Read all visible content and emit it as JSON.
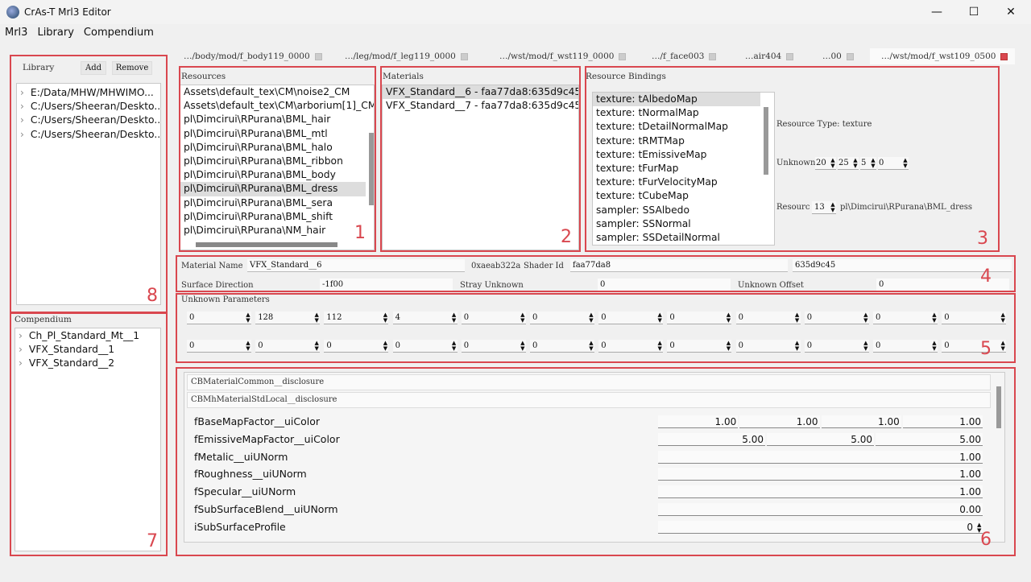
{
  "window": {
    "title": "CrAs-T Mrl3 Editor",
    "minimize": "—",
    "maximize": "☐",
    "close": "✕"
  },
  "menu": [
    "Mrl3",
    "Library",
    "Compendium"
  ],
  "tabs": [
    {
      "label": "…/body/mod/f_body119_0000",
      "active": false
    },
    {
      "label": "…/leg/mod/f_leg119_0000",
      "active": false
    },
    {
      "label": "…/wst/mod/f_wst119_0000",
      "active": false
    },
    {
      "label": "…/f_face003",
      "active": false
    },
    {
      "label": "…air404",
      "active": false
    },
    {
      "label": "…00",
      "active": false
    },
    {
      "label": "…/wst/mod/f_wst109_0500",
      "active": true
    }
  ],
  "library": {
    "title": "Library",
    "add": "Add",
    "remove": "Remove",
    "items": [
      "E:/Data/MHW/MHWIMO...",
      "C:/Users/Sheeran/Deskto...",
      "C:/Users/Sheeran/Deskto...",
      "C:/Users/Sheeran/Deskto..."
    ]
  },
  "compendium": {
    "title": "Compendium",
    "items": [
      "Ch_Pl_Standard_Mt__1",
      "VFX_Standard__1",
      "VFX_Standard__2"
    ]
  },
  "resources": {
    "title": "Resources",
    "selected": 7,
    "items": [
      "Assets\\default_tex\\CM\\noise2_CM",
      "Assets\\default_tex\\CM\\arborium[1]_CM",
      "pl\\Dimcirui\\RPurana\\BML_hair",
      "pl\\Dimcirui\\RPurana\\BML_mtl",
      "pl\\Dimcirui\\RPurana\\BML_halo",
      "pl\\Dimcirui\\RPurana\\BML_ribbon",
      "pl\\Dimcirui\\RPurana\\BML_body",
      "pl\\Dimcirui\\RPurana\\BML_dress",
      "pl\\Dimcirui\\RPurana\\BML_sera",
      "pl\\Dimcirui\\RPurana\\BML_shift",
      "pl\\Dimcirui\\RPurana\\NM_hair"
    ]
  },
  "materials": {
    "title": "Materials",
    "selected": 0,
    "items": [
      "VFX_Standard__6 - faa77da8:635d9c45",
      "VFX_Standard__7 - faa77da8:635d9c45"
    ]
  },
  "bindings": {
    "title": "Resource Bindings",
    "selected": 0,
    "items": [
      "texture: tAlbedoMap",
      "texture: tNormalMap",
      "texture: tDetailNormalMap",
      "texture: tRMTMap",
      "texture: tEmissiveMap",
      "texture: tFurMap",
      "texture: tFurVelocityMap",
      "texture: tCubeMap",
      "sampler: SSAlbedo",
      "sampler: SSNormal",
      "sampler: SSDetailNormal"
    ],
    "resource_type": "Resource Type: texture",
    "unknowns_label": "Unknowns",
    "unknowns": [
      "20",
      "25",
      "5",
      "0"
    ],
    "resource_label": "Resourc",
    "resource_index": "13",
    "resource_path": "pl\\Dimcirui\\RPurana\\BML_dress"
  },
  "material": {
    "name_label": "Material Name",
    "name": "VFX_Standard__6",
    "hash": "0xaeab322a",
    "shader_label": "Shader Id",
    "shader_id": "faa77da8",
    "extra_id": "635d9c45",
    "surface_label": "Surface Direction",
    "surface": "-1f00",
    "stray_label": "Stray Unknown",
    "stray": "0",
    "offset_label": "Unknown Offset",
    "offset": "0"
  },
  "unknown_params": {
    "title": "Unknown Parameters",
    "row1": [
      "0",
      "128",
      "112",
      "4",
      "0",
      "0",
      "0",
      "0",
      "0",
      "0",
      "0",
      "0"
    ],
    "row2": [
      "0",
      "0",
      "0",
      "0",
      "0",
      "0",
      "0",
      "0",
      "0",
      "0",
      "0",
      "0"
    ]
  },
  "properties": {
    "sections": [
      "CBMaterialCommon__disclosure",
      "CBMhMaterialStdLocal__disclosure"
    ],
    "rows": [
      {
        "label": "fBaseMapFactor__uiColor",
        "values": [
          "1.00",
          "1.00",
          "1.00",
          "1.00"
        ]
      },
      {
        "label": "fEmissiveMapFactor__uiColor",
        "values": [
          "5.00",
          "5.00",
          "5.00"
        ]
      },
      {
        "label": "fMetalic__uiUNorm",
        "values": [
          "1.00"
        ]
      },
      {
        "label": "fRoughness__uiUNorm",
        "values": [
          "1.00"
        ]
      },
      {
        "label": "fSpecular__uiUNorm",
        "values": [
          "1.00"
        ]
      },
      {
        "label": "fSubSurfaceBlend__uiUNorm",
        "values": [
          "0.00"
        ]
      },
      {
        "label": "iSubSurfaceProfile",
        "values": [
          "0"
        ]
      }
    ]
  },
  "annotations": [
    "1",
    "2",
    "3",
    "4",
    "5",
    "6",
    "7",
    "8"
  ],
  "colors": {
    "annotation": "#d9474f",
    "selection": "#dddddd"
  }
}
